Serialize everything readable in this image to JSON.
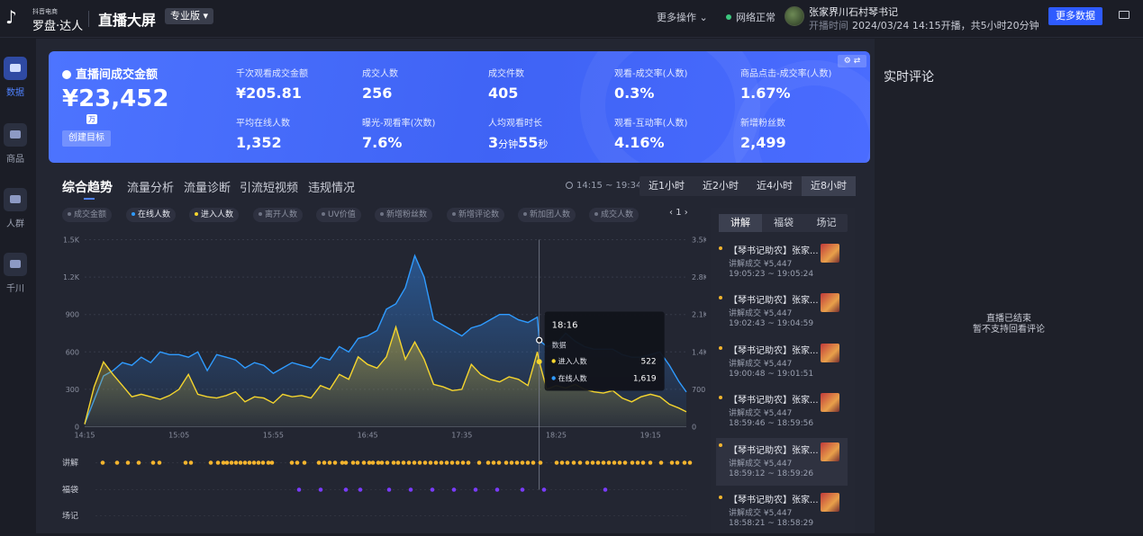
{
  "header": {
    "logo_small": "抖音电商",
    "logo_big": "罗盘·达人",
    "title": "直播大屏",
    "edition": "专业版",
    "more_ops": "更多操作",
    "network": "网络正常",
    "host_name": "张家界川石村琴书记",
    "start_label": "开播时间",
    "start_value": "2024/03/24 14:15开播，共5小时20分钟",
    "more_data": "更多数据"
  },
  "nav": [
    {
      "label": "数据",
      "icon": "chart-icon",
      "active": true
    },
    {
      "label": "商品",
      "icon": "cart-icon",
      "active": false
    },
    {
      "label": "人群",
      "icon": "people-icon",
      "active": false
    },
    {
      "label": "千川",
      "icon": "ad-icon",
      "active": false
    }
  ],
  "kpi": {
    "headline_label": "直播间成交金额",
    "headline_value": "¥23,452",
    "unit_badge": "万",
    "goal_button": "创建目标",
    "metrics": [
      {
        "label": "千次观看成交金额",
        "value": "¥205.81"
      },
      {
        "label": "成交人数",
        "value": "256"
      },
      {
        "label": "成交件数",
        "value": "405"
      },
      {
        "label": "观看-成交率(人数)",
        "value": "0.3%"
      },
      {
        "label": "商品点击-成交率(人数)",
        "value": "1.67%"
      },
      {
        "label": "平均在线人数",
        "value": "1,352"
      },
      {
        "label": "曝光-观看率(次数)",
        "value": "7.6%"
      },
      {
        "label": "人均观看时长",
        "value_num1": "3",
        "value_unit1": "分钟",
        "value_num2": "55",
        "value_unit2": "秒"
      },
      {
        "label": "观看-互动率(人数)",
        "value": "4.16%"
      },
      {
        "label": "新增粉丝数",
        "value": "2,499"
      }
    ]
  },
  "tabs": [
    "综合趋势",
    "流量分析",
    "流量诊断",
    "引流短视频",
    "违规情况"
  ],
  "time_range": "14:15 ~ 19:34",
  "periods": [
    "近1小时",
    "近2小时",
    "近4小时",
    "近8小时"
  ],
  "active_period": 3,
  "chips": [
    {
      "label": "成交金额",
      "on": false,
      "color": "#6e7384"
    },
    {
      "label": "在线人数",
      "on": true,
      "color": "#2f9bff"
    },
    {
      "label": "进入人数",
      "on": true,
      "color": "#f5d52e"
    },
    {
      "label": "离开人数",
      "on": false,
      "color": "#6e7384"
    },
    {
      "label": "UV价值",
      "on": false,
      "color": "#6e7384"
    },
    {
      "label": "新增粉丝数",
      "on": false,
      "color": "#6e7384"
    },
    {
      "label": "新增评论数",
      "on": false,
      "color": "#6e7384"
    },
    {
      "label": "新加团人数",
      "on": false,
      "color": "#6e7384"
    },
    {
      "label": "成交人数",
      "on": false,
      "color": "#6e7384"
    }
  ],
  "pager": "1",
  "side": {
    "tabs": [
      "讲解",
      "福袋",
      "场记"
    ],
    "items": [
      {
        "title": "【琴书记助农】张家...",
        "price": "讲解成交 ¥5,447",
        "time": "19:05:23 ~ 19:05:24"
      },
      {
        "title": "【琴书记助农】张家...",
        "price": "讲解成交 ¥5,447",
        "time": "19:02:43 ~ 19:04:59"
      },
      {
        "title": "【琴书记助农】张家...",
        "price": "讲解成交 ¥5,447",
        "time": "19:00:48 ~ 19:01:51"
      },
      {
        "title": "【琴书记助农】张家...",
        "price": "讲解成交 ¥5,447",
        "time": "18:59:46 ~ 18:59:56"
      },
      {
        "title": "【琴书记助农】张家...",
        "price": "讲解成交 ¥5,447",
        "time": "18:59:12 ~ 18:59:26"
      },
      {
        "title": "【琴书记助农】张家...",
        "price": "讲解成交 ¥5,447",
        "time": "18:58:21 ~ 18:58:29"
      }
    ]
  },
  "comments": {
    "title": "实时评论",
    "empty_line1": "直播已结束",
    "empty_line2": "暂不支持回看评论"
  },
  "chart_data": {
    "type": "line",
    "x_ticks": [
      "14:15",
      "15:05",
      "15:55",
      "16:45",
      "17:35",
      "18:25",
      "19:15"
    ],
    "y_left_ticks": [
      "0",
      "300",
      "600",
      "900",
      "1.2K",
      "1.5K"
    ],
    "y_right_ticks": [
      "0",
      "700",
      "1.4K",
      "2.1K",
      "2.8K",
      "3.5K"
    ],
    "ylim_left": [
      0,
      1500
    ],
    "ylim_right": [
      0,
      3500
    ],
    "series": [
      {
        "name": "在线人数",
        "axis": "right",
        "color": "#2f9bff",
        "x": [
          "14:15",
          "14:20",
          "14:25",
          "14:30",
          "14:35",
          "14:40",
          "14:45",
          "14:50",
          "14:55",
          "15:00",
          "15:05",
          "15:10",
          "15:15",
          "15:20",
          "15:25",
          "15:30",
          "15:35",
          "15:40",
          "15:45",
          "15:50",
          "15:55",
          "16:00",
          "16:05",
          "16:10",
          "16:15",
          "16:20",
          "16:25",
          "16:30",
          "16:35",
          "16:40",
          "16:45",
          "16:50",
          "16:55",
          "17:00",
          "17:05",
          "17:10",
          "17:15",
          "17:20",
          "17:25",
          "17:30",
          "17:35",
          "17:40",
          "17:45",
          "17:50",
          "17:55",
          "18:00",
          "18:05",
          "18:10",
          "18:15",
          "18:16",
          "18:20",
          "18:25",
          "18:30",
          "18:35",
          "18:40",
          "18:45",
          "18:50",
          "18:55",
          "19:00",
          "19:05",
          "19:10",
          "19:15",
          "19:20",
          "19:25",
          "19:30",
          "19:34"
        ],
        "y": [
          50,
          500,
          950,
          1050,
          1200,
          1150,
          1300,
          1200,
          1400,
          1350,
          1350,
          1300,
          1400,
          1050,
          1350,
          1300,
          1250,
          1100,
          1200,
          1150,
          1000,
          1100,
          1200,
          1150,
          1100,
          1300,
          1250,
          1500,
          1400,
          1650,
          1700,
          1800,
          2200,
          2300,
          2600,
          3200,
          2800,
          2000,
          1900,
          1800,
          1700,
          1850,
          1900,
          2000,
          2100,
          2100,
          2000,
          1950,
          2050,
          1619,
          1500,
          1550,
          1750,
          1600,
          1500,
          1450,
          1450,
          1450,
          1350,
          1300,
          1300,
          1350,
          1400,
          1150,
          850,
          650
        ]
      },
      {
        "name": "进入人数",
        "axis": "left",
        "color": "#f5d52e",
        "x": [
          "14:15",
          "14:20",
          "14:25",
          "14:30",
          "14:35",
          "14:40",
          "14:45",
          "14:50",
          "14:55",
          "15:00",
          "15:05",
          "15:10",
          "15:15",
          "15:20",
          "15:25",
          "15:30",
          "15:35",
          "15:40",
          "15:45",
          "15:50",
          "15:55",
          "16:00",
          "16:05",
          "16:10",
          "16:15",
          "16:20",
          "16:25",
          "16:30",
          "16:35",
          "16:40",
          "16:45",
          "16:50",
          "16:55",
          "17:00",
          "17:05",
          "17:10",
          "17:15",
          "17:20",
          "17:25",
          "17:30",
          "17:35",
          "17:40",
          "17:45",
          "17:50",
          "17:55",
          "18:00",
          "18:05",
          "18:10",
          "18:15",
          "18:16",
          "18:20",
          "18:25",
          "18:30",
          "18:35",
          "18:40",
          "18:45",
          "18:50",
          "18:55",
          "19:00",
          "19:05",
          "19:10",
          "19:15",
          "19:20",
          "19:25",
          "19:30",
          "19:34"
        ],
        "y": [
          20,
          320,
          520,
          420,
          330,
          240,
          260,
          240,
          220,
          250,
          300,
          420,
          260,
          240,
          230,
          250,
          280,
          200,
          240,
          230,
          190,
          260,
          240,
          250,
          230,
          330,
          300,
          420,
          380,
          560,
          500,
          470,
          560,
          800,
          540,
          680,
          540,
          340,
          320,
          290,
          300,
          500,
          420,
          380,
          360,
          400,
          380,
          330,
          600,
          522,
          300,
          330,
          310,
          340,
          300,
          280,
          270,
          290,
          230,
          200,
          240,
          260,
          240,
          180,
          150,
          120
        ]
      }
    ],
    "tooltip": {
      "time": "18:16",
      "heading": "数据",
      "rows": [
        {
          "name": "进入人数",
          "value": "522"
        },
        {
          "name": "在线人数",
          "value": "1,619"
        }
      ]
    },
    "event_rows": [
      {
        "label": "讲解",
        "color": "#f5b52e"
      },
      {
        "label": "福袋",
        "color": "#7a3cff"
      },
      {
        "label": "场记",
        "color": "#888888"
      }
    ]
  }
}
